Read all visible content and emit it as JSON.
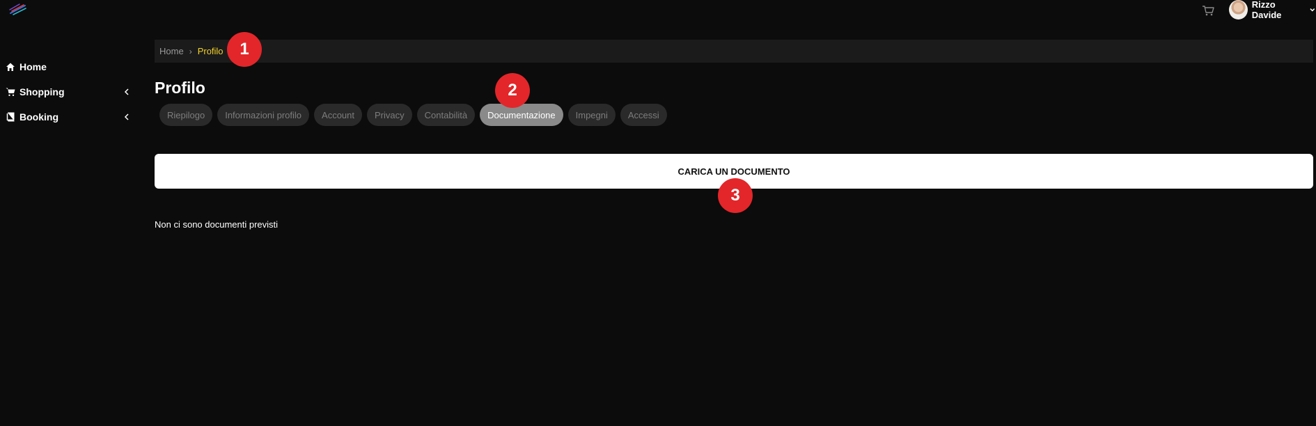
{
  "header": {
    "user_name": "Rizzo Davide",
    "icons": {
      "logo": "brand-logo",
      "cart": "cart-icon",
      "user_menu": "chevron-down-icon"
    }
  },
  "sidebar": {
    "items": [
      {
        "label": "Home",
        "icon": "home-icon",
        "has_submenu": false
      },
      {
        "label": "Shopping",
        "icon": "cart-icon",
        "has_submenu": true
      },
      {
        "label": "Booking",
        "icon": "book-icon",
        "has_submenu": true
      }
    ]
  },
  "breadcrumb": {
    "home": "Home",
    "current": "Profilo"
  },
  "page": {
    "title": "Profilo"
  },
  "tabs": [
    {
      "label": "Riepilogo",
      "active": false
    },
    {
      "label": "Informazioni profilo",
      "active": false
    },
    {
      "label": "Account",
      "active": false
    },
    {
      "label": "Privacy",
      "active": false
    },
    {
      "label": "Contabilità",
      "active": false
    },
    {
      "label": "Documentazione",
      "active": true
    },
    {
      "label": "Impegni",
      "active": false
    },
    {
      "label": "Accessi",
      "active": false
    }
  ],
  "content": {
    "upload_button": "CARICA UN DOCUMENTO",
    "empty_message": "Non ci sono documenti previsti"
  },
  "callouts": [
    "1",
    "2",
    "3"
  ],
  "colors": {
    "background": "#0c0c0c",
    "breadcrumb_active": "#f5d22a",
    "callout": "#e3262a",
    "tab_active": "#8a8a8a",
    "tab_inactive": "#2a2a2a"
  }
}
